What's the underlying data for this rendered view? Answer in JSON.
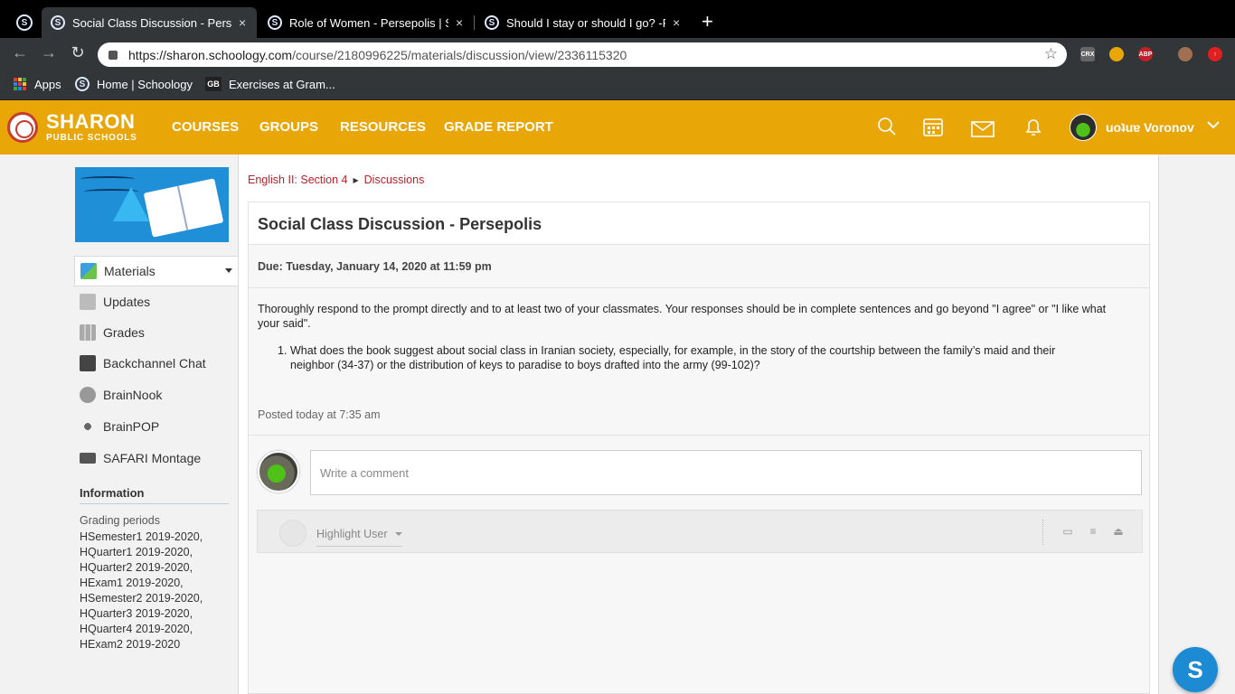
{
  "browser": {
    "tabs": [
      {
        "title": "Social Class Discussion - Perse"
      },
      {
        "title": "Role of Women - Persepolis | S"
      },
      {
        "title": "Should I stay or should I go? -F"
      }
    ],
    "tab_fav_letter": "S",
    "close_glyph": "×",
    "new_tab_glyph": "+",
    "url_host": "https://sharon.schoology.com",
    "url_path": "/course/2180996225/materials/discussion/view/2336115320",
    "extensions": [
      "CRX",
      "ABP"
    ],
    "bookmarks": [
      {
        "label": "Apps"
      },
      {
        "label": "Home | Schoology"
      },
      {
        "label": "Exercises at Gram..."
      }
    ],
    "gb_text": "GB"
  },
  "header": {
    "logo_line1": "SHARON",
    "logo_line2": "PUBLIC SCHOOLS",
    "nav": [
      "COURSES",
      "GROUPS",
      "RESOURCES",
      "GRADE REPORT"
    ],
    "username": "uoʇuɐ Voronov",
    "accent_color": "#e8a607"
  },
  "sidebar": {
    "items": [
      {
        "label": "Materials"
      },
      {
        "label": "Updates"
      },
      {
        "label": "Grades"
      },
      {
        "label": "Backchannel Chat"
      },
      {
        "label": "BrainNook"
      },
      {
        "label": "BrainPOP"
      },
      {
        "label": "SAFARI Montage"
      }
    ],
    "info_heading": "Information",
    "grading_label": "Grading periods",
    "periods": [
      "HSemester1 2019-2020,",
      "HQuarter1 2019-2020,",
      "HQuarter2 2019-2020,",
      "HExam1 2019-2020,",
      "HSemester2 2019-2020,",
      "HQuarter3 2019-2020,",
      "HQuarter4 2019-2020,",
      "HExam2 2019-2020"
    ]
  },
  "breadcrumb": {
    "course": "English II: Section 4",
    "section": "Discussions"
  },
  "discussion": {
    "title": "Social Class Discussion - Persepolis",
    "due": "Due: Tuesday, January 14, 2020 at 11:59 pm",
    "prompt": "Thoroughly respond to the prompt directly and to at least two of your classmates. Your responses should be in complete sentences and go beyond \"I agree\" or \"I like what your said\".",
    "question_number": "1.",
    "question": "What does the book suggest about social class in Iranian society, especially, for example, in the story of the courtship between the family’s maid and their neighbor (34-37) or the distribution of keys to paradise to boys drafted into the army (99-102)?",
    "posted": "Posted today at 7:35 am"
  },
  "comments": {
    "placeholder": "Write a comment",
    "highlight_label": "Highlight User"
  },
  "fab_letter": "S"
}
